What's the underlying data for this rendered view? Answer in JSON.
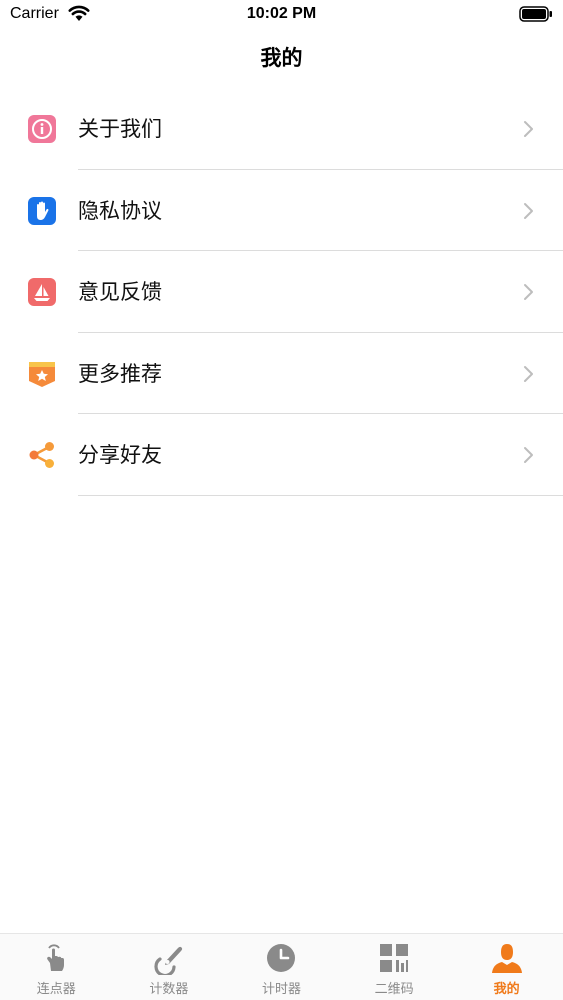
{
  "status_bar": {
    "carrier": "Carrier",
    "time": "10:02 PM"
  },
  "nav": {
    "title": "我的"
  },
  "menu": {
    "items": [
      {
        "label": "关于我们",
        "icon": "info-icon",
        "color": "#f07799"
      },
      {
        "label": "隐私协议",
        "icon": "hand-icon",
        "color": "#1a73e8"
      },
      {
        "label": "意见反馈",
        "icon": "feedback-icon",
        "color": "#f06a6a"
      },
      {
        "label": "更多推荐",
        "icon": "star-badge-icon",
        "color": "#f58a3a"
      },
      {
        "label": "分享好友",
        "icon": "share-icon",
        "color": "#f59a3a"
      }
    ]
  },
  "tab_bar": {
    "active_color": "#f07a1a",
    "inactive_color": "#8a8a8a",
    "tabs": [
      {
        "label": "连点器",
        "icon": "tap-hand-icon",
        "active": false
      },
      {
        "label": "计数器",
        "icon": "counter-icon",
        "active": false
      },
      {
        "label": "计时器",
        "icon": "clock-icon",
        "active": false
      },
      {
        "label": "二维码",
        "icon": "qrcode-icon",
        "active": false
      },
      {
        "label": "我的",
        "icon": "person-icon",
        "active": true
      }
    ]
  }
}
